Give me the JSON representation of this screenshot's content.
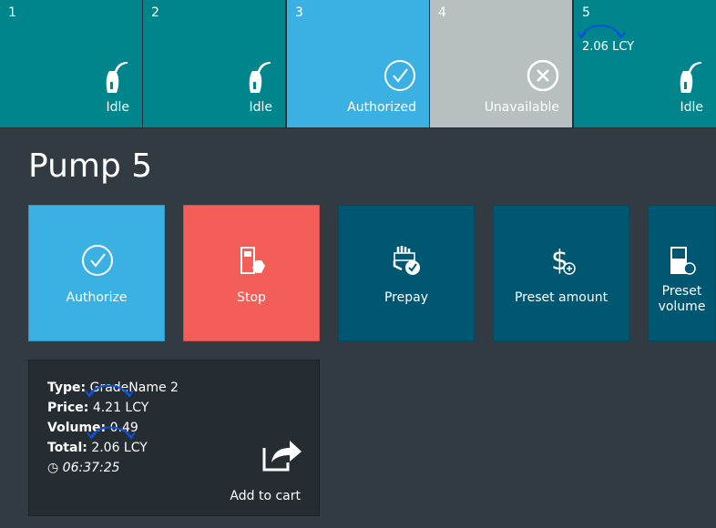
{
  "pumps": [
    {
      "number": "1",
      "status": "Idle",
      "icon": "fuel-nozzle-icon",
      "color": "#00858c"
    },
    {
      "number": "2",
      "status": "Idle",
      "icon": "fuel-nozzle-icon",
      "color": "#00858c"
    },
    {
      "number": "3",
      "status": "Authorized",
      "icon": "check-circle-icon",
      "color": "#3bb1e3"
    },
    {
      "number": "4",
      "status": "Unavailable",
      "icon": "close-circle-icon",
      "color": "#b8bfc1"
    },
    {
      "number": "5",
      "status": "Idle",
      "icon": "fuel-nozzle-icon",
      "color": "#00858c",
      "amount": "2.06 LCY"
    }
  ],
  "title": "Pump 5",
  "actions": [
    {
      "label": "Authorize",
      "icon": "check-circle-icon",
      "color": "#3bb1e3"
    },
    {
      "label": "Stop",
      "icon": "stop-pump-icon",
      "color": "#f45e58"
    },
    {
      "label": "Prepay",
      "icon": "prepay-icon",
      "color": "#005772"
    },
    {
      "label": "Preset amount",
      "icon": "dollar-plus-icon",
      "color": "#005772"
    },
    {
      "label": "Preset volume",
      "icon": "preset-volume-icon",
      "color": "#005772"
    }
  ],
  "transaction": {
    "type_label": "Type:",
    "type": "GradeName 2",
    "price_label": "Price:",
    "price": "4.21 LCY",
    "volume_label": "Volume:",
    "volume": "0.49",
    "total_label": "Total:",
    "total": "2.06 LCY",
    "time": "06:37:25",
    "add_to_cart": "Add to cart"
  }
}
